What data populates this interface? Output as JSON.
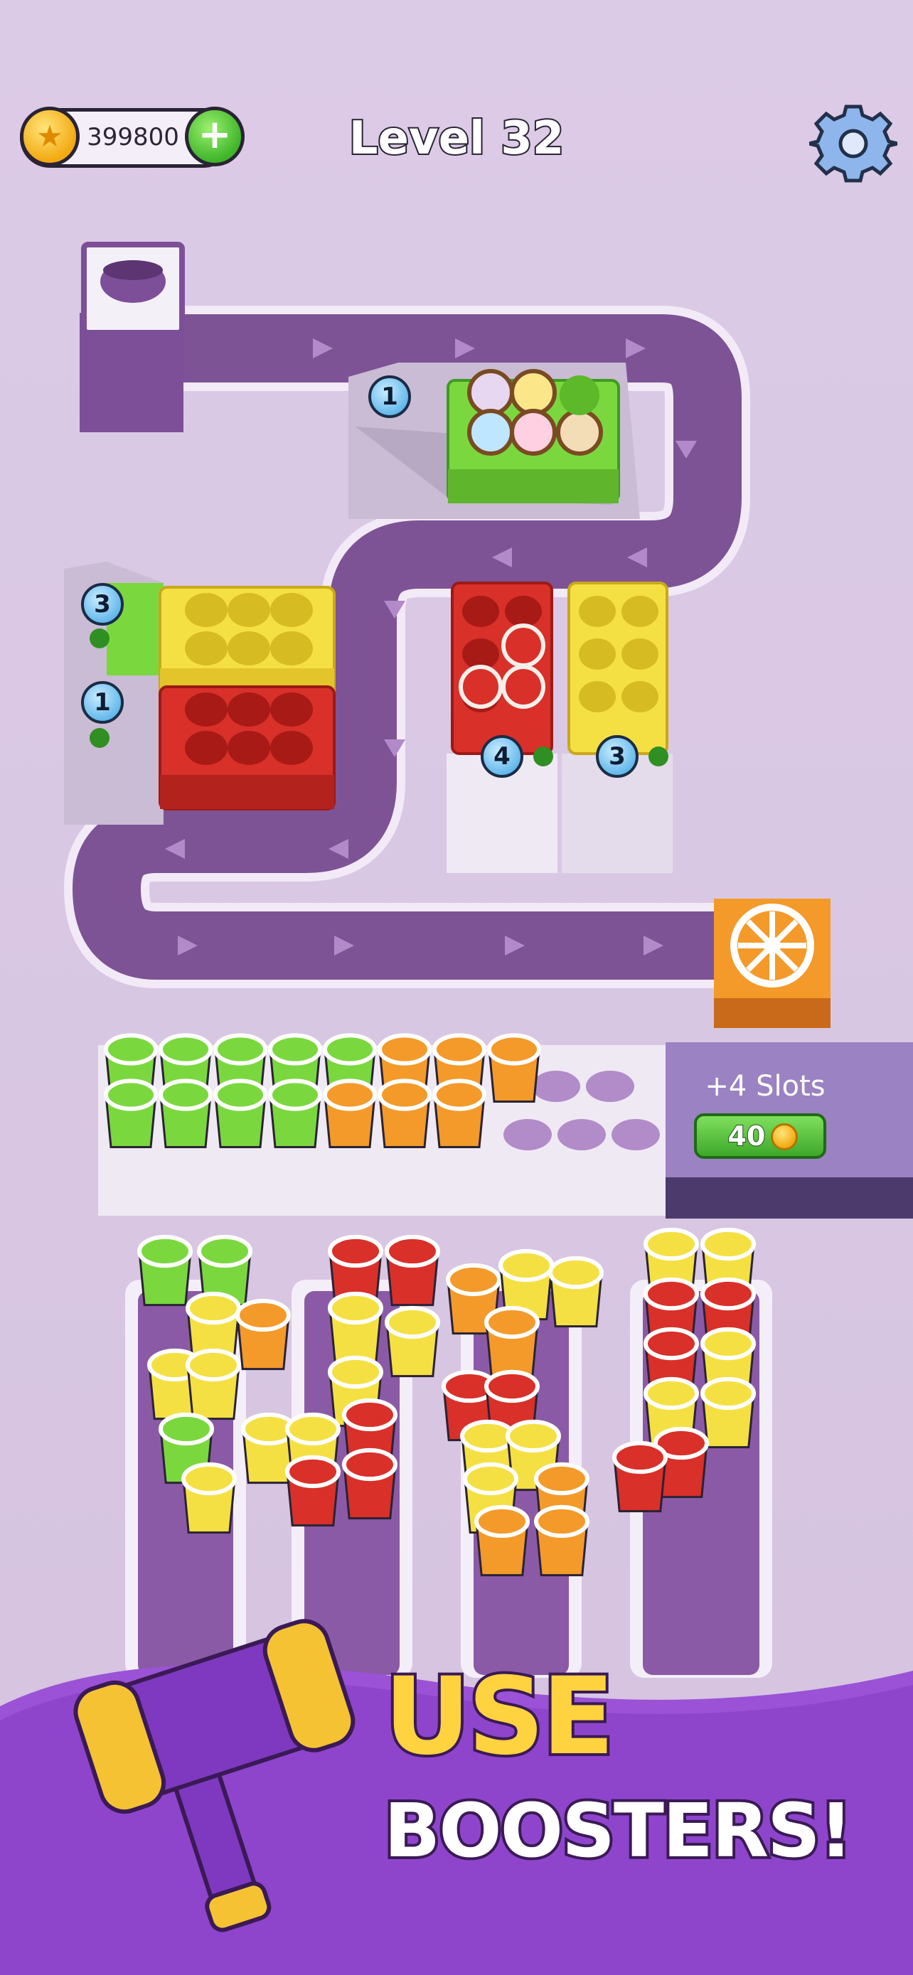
{
  "hud": {
    "coins": "399800",
    "level": "Level 32",
    "icons": {
      "coin": "star-coin-icon",
      "add": "plus-icon",
      "settings": "gear-icon"
    }
  },
  "board": {
    "badges": [
      "1",
      "3",
      "1",
      "4",
      "3"
    ],
    "extra_slots": {
      "label": "+4 Slots",
      "cost": "40"
    }
  },
  "promo": {
    "line1": "USE",
    "line2": "BOOSTERS!"
  },
  "colors": {
    "track": "#7d5396",
    "green": "#7ad83e",
    "orange": "#f39a2a",
    "red": "#d9302a",
    "yellow": "#f5e043",
    "banner": "#9b52d6"
  }
}
